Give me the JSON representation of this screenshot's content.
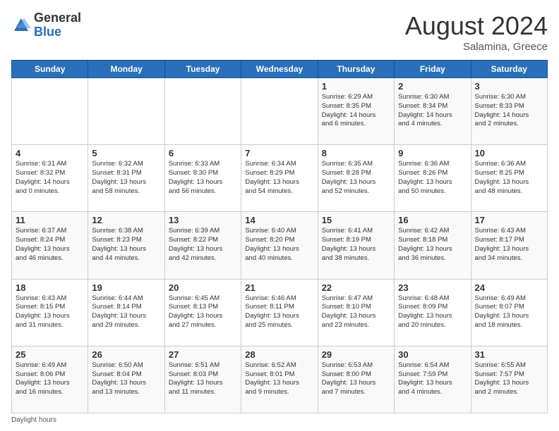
{
  "header": {
    "logo_general": "General",
    "logo_blue": "Blue",
    "month_title": "August 2024",
    "location": "Salamina, Greece"
  },
  "footer": {
    "daylight_label": "Daylight hours"
  },
  "weekdays": [
    "Sunday",
    "Monday",
    "Tuesday",
    "Wednesday",
    "Thursday",
    "Friday",
    "Saturday"
  ],
  "weeks": [
    [
      {
        "day": "",
        "info": ""
      },
      {
        "day": "",
        "info": ""
      },
      {
        "day": "",
        "info": ""
      },
      {
        "day": "",
        "info": ""
      },
      {
        "day": "1",
        "info": "Sunrise: 6:29 AM\nSunset: 8:35 PM\nDaylight: 14 hours\nand 6 minutes."
      },
      {
        "day": "2",
        "info": "Sunrise: 6:30 AM\nSunset: 8:34 PM\nDaylight: 14 hours\nand 4 minutes."
      },
      {
        "day": "3",
        "info": "Sunrise: 6:30 AM\nSunset: 8:33 PM\nDaylight: 14 hours\nand 2 minutes."
      }
    ],
    [
      {
        "day": "4",
        "info": "Sunrise: 6:31 AM\nSunset: 8:32 PM\nDaylight: 14 hours\nand 0 minutes."
      },
      {
        "day": "5",
        "info": "Sunrise: 6:32 AM\nSunset: 8:31 PM\nDaylight: 13 hours\nand 58 minutes."
      },
      {
        "day": "6",
        "info": "Sunrise: 6:33 AM\nSunset: 8:30 PM\nDaylight: 13 hours\nand 56 minutes."
      },
      {
        "day": "7",
        "info": "Sunrise: 6:34 AM\nSunset: 8:29 PM\nDaylight: 13 hours\nand 54 minutes."
      },
      {
        "day": "8",
        "info": "Sunrise: 6:35 AM\nSunset: 8:28 PM\nDaylight: 13 hours\nand 52 minutes."
      },
      {
        "day": "9",
        "info": "Sunrise: 6:36 AM\nSunset: 8:26 PM\nDaylight: 13 hours\nand 50 minutes."
      },
      {
        "day": "10",
        "info": "Sunrise: 6:36 AM\nSunset: 8:25 PM\nDaylight: 13 hours\nand 48 minutes."
      }
    ],
    [
      {
        "day": "11",
        "info": "Sunrise: 6:37 AM\nSunset: 8:24 PM\nDaylight: 13 hours\nand 46 minutes."
      },
      {
        "day": "12",
        "info": "Sunrise: 6:38 AM\nSunset: 8:23 PM\nDaylight: 13 hours\nand 44 minutes."
      },
      {
        "day": "13",
        "info": "Sunrise: 6:39 AM\nSunset: 8:22 PM\nDaylight: 13 hours\nand 42 minutes."
      },
      {
        "day": "14",
        "info": "Sunrise: 6:40 AM\nSunset: 8:20 PM\nDaylight: 13 hours\nand 40 minutes."
      },
      {
        "day": "15",
        "info": "Sunrise: 6:41 AM\nSunset: 8:19 PM\nDaylight: 13 hours\nand 38 minutes."
      },
      {
        "day": "16",
        "info": "Sunrise: 6:42 AM\nSunset: 8:18 PM\nDaylight: 13 hours\nand 36 minutes."
      },
      {
        "day": "17",
        "info": "Sunrise: 6:43 AM\nSunset: 8:17 PM\nDaylight: 13 hours\nand 34 minutes."
      }
    ],
    [
      {
        "day": "18",
        "info": "Sunrise: 6:43 AM\nSunset: 8:15 PM\nDaylight: 13 hours\nand 31 minutes."
      },
      {
        "day": "19",
        "info": "Sunrise: 6:44 AM\nSunset: 8:14 PM\nDaylight: 13 hours\nand 29 minutes."
      },
      {
        "day": "20",
        "info": "Sunrise: 6:45 AM\nSunset: 8:13 PM\nDaylight: 13 hours\nand 27 minutes."
      },
      {
        "day": "21",
        "info": "Sunrise: 6:46 AM\nSunset: 8:11 PM\nDaylight: 13 hours\nand 25 minutes."
      },
      {
        "day": "22",
        "info": "Sunrise: 6:47 AM\nSunset: 8:10 PM\nDaylight: 13 hours\nand 23 minutes."
      },
      {
        "day": "23",
        "info": "Sunrise: 6:48 AM\nSunset: 8:09 PM\nDaylight: 13 hours\nand 20 minutes."
      },
      {
        "day": "24",
        "info": "Sunrise: 6:49 AM\nSunset: 8:07 PM\nDaylight: 13 hours\nand 18 minutes."
      }
    ],
    [
      {
        "day": "25",
        "info": "Sunrise: 6:49 AM\nSunset: 8:06 PM\nDaylight: 13 hours\nand 16 minutes."
      },
      {
        "day": "26",
        "info": "Sunrise: 6:50 AM\nSunset: 8:04 PM\nDaylight: 13 hours\nand 13 minutes."
      },
      {
        "day": "27",
        "info": "Sunrise: 6:51 AM\nSunset: 8:03 PM\nDaylight: 13 hours\nand 11 minutes."
      },
      {
        "day": "28",
        "info": "Sunrise: 6:52 AM\nSunset: 8:01 PM\nDaylight: 13 hours\nand 9 minutes."
      },
      {
        "day": "29",
        "info": "Sunrise: 6:53 AM\nSunset: 8:00 PM\nDaylight: 13 hours\nand 7 minutes."
      },
      {
        "day": "30",
        "info": "Sunrise: 6:54 AM\nSunset: 7:59 PM\nDaylight: 13 hours\nand 4 minutes."
      },
      {
        "day": "31",
        "info": "Sunrise: 6:55 AM\nSunset: 7:57 PM\nDaylight: 13 hours\nand 2 minutes."
      }
    ]
  ]
}
